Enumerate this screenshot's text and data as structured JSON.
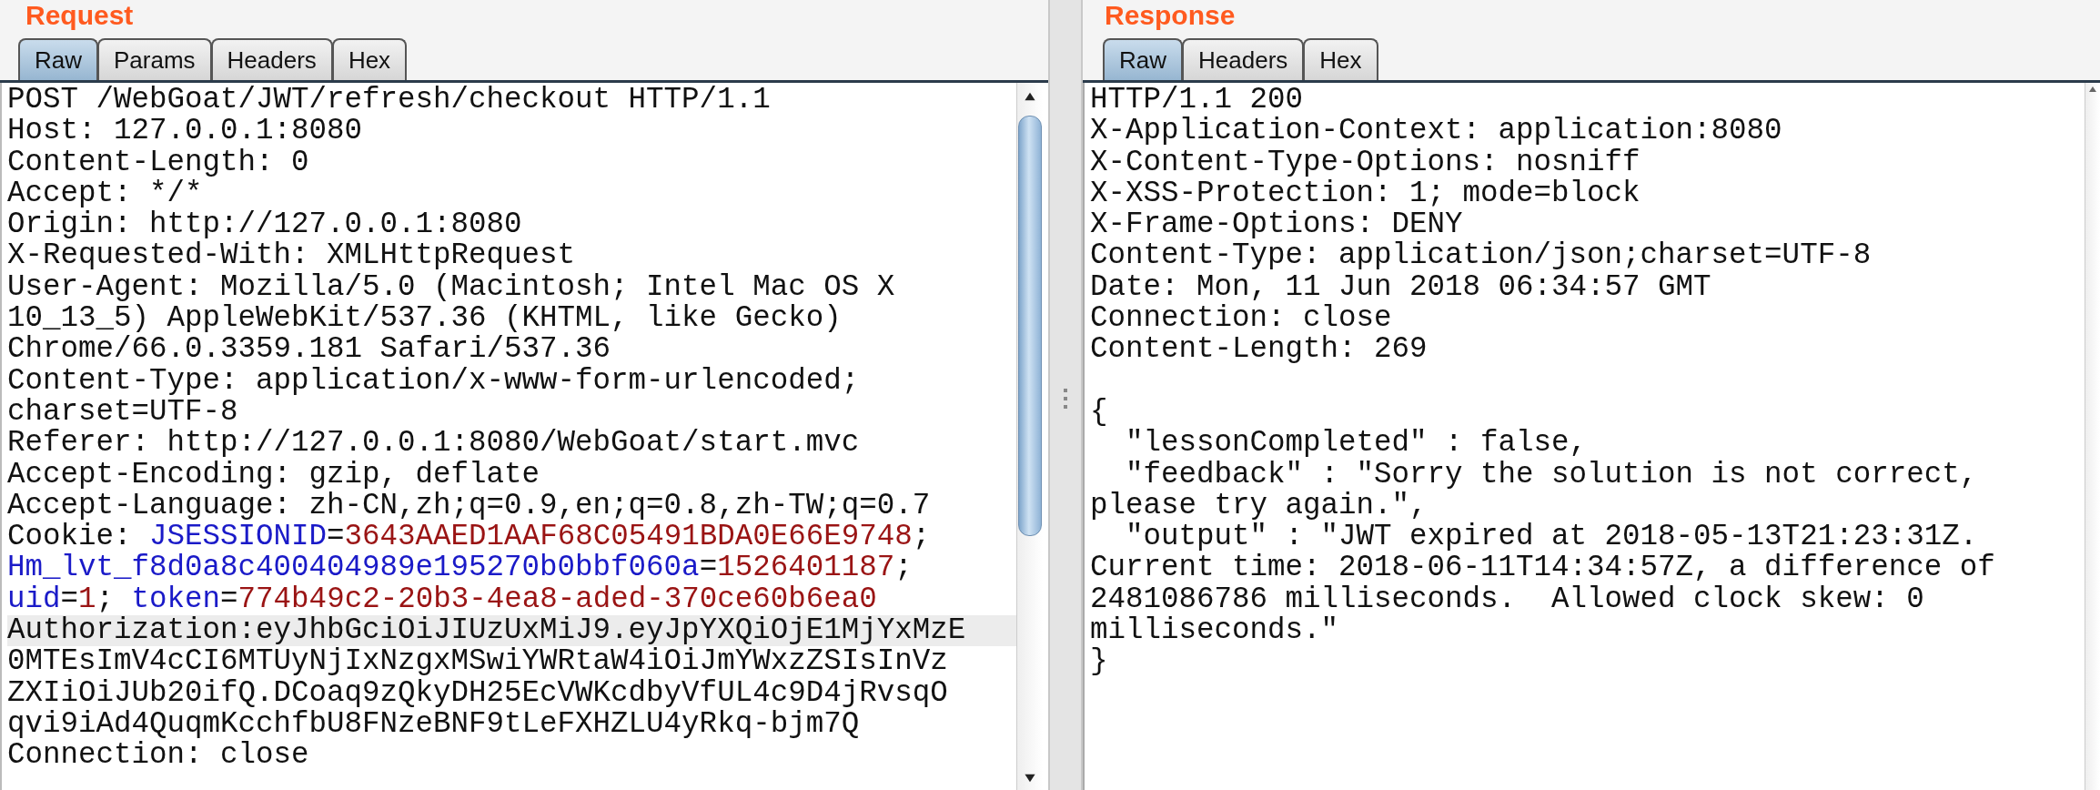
{
  "request": {
    "title": "Request",
    "tabs": [
      {
        "label": "Raw",
        "selected": true
      },
      {
        "label": "Params",
        "selected": false
      },
      {
        "label": "Headers",
        "selected": false
      },
      {
        "label": "Hex",
        "selected": false
      }
    ],
    "lines": [
      {
        "text": "POST /WebGoat/JWT/refresh/checkout HTTP/1.1",
        "highlighted": false
      },
      {
        "text": "Host: 127.0.0.1:8080",
        "highlighted": false
      },
      {
        "text": "Content-Length: 0",
        "highlighted": false
      },
      {
        "text": "Accept: */*",
        "highlighted": false
      },
      {
        "text": "Origin: http://127.0.0.1:8080",
        "highlighted": false
      },
      {
        "text": "X-Requested-With: XMLHttpRequest",
        "highlighted": false
      },
      {
        "text": "User-Agent: Mozilla/5.0 (Macintosh; Intel Mac OS X",
        "highlighted": false
      },
      {
        "text": "10_13_5) AppleWebKit/537.36 (KHTML, like Gecko)",
        "highlighted": false
      },
      {
        "text": "Chrome/66.0.3359.181 Safari/537.36",
        "highlighted": false
      },
      {
        "text": "Content-Type: application/x-www-form-urlencoded;",
        "highlighted": false
      },
      {
        "text": "charset=UTF-8",
        "highlighted": false
      },
      {
        "text": "Referer: http://127.0.0.1:8080/WebGoat/start.mvc",
        "highlighted": false
      },
      {
        "text": "Accept-Encoding: gzip, deflate",
        "highlighted": false
      },
      {
        "text": "Accept-Language: zh-CN,zh;q=0.9,en;q=0.8,zh-TW;q=0.7",
        "highlighted": false
      },
      {
        "highlighted": false,
        "segments": [
          {
            "kind": "plain",
            "text": "Cookie: "
          },
          {
            "kind": "name",
            "text": "JSESSIONID"
          },
          {
            "kind": "plain",
            "text": "="
          },
          {
            "kind": "value",
            "text": "3643AAED1AAF68C05491BDA0E66E9748"
          },
          {
            "kind": "plain",
            "text": ";"
          }
        ]
      },
      {
        "highlighted": false,
        "segments": [
          {
            "kind": "name",
            "text": "Hm_lvt_f8d0a8c400404989e195270b0bbf060a"
          },
          {
            "kind": "plain",
            "text": "="
          },
          {
            "kind": "value",
            "text": "1526401187"
          },
          {
            "kind": "plain",
            "text": ";"
          }
        ]
      },
      {
        "highlighted": false,
        "segments": [
          {
            "kind": "name",
            "text": "uid"
          },
          {
            "kind": "plain",
            "text": "="
          },
          {
            "kind": "value",
            "text": "1"
          },
          {
            "kind": "plain",
            "text": "; "
          },
          {
            "kind": "name",
            "text": "token"
          },
          {
            "kind": "plain",
            "text": "="
          },
          {
            "kind": "value",
            "text": "774b49c2-20b3-4ea8-aded-370ce60b6ea0"
          }
        ]
      },
      {
        "text": "Authorization:eyJhbGciOiJIUzUxMiJ9.eyJpYXQiOjE1MjYxMzE",
        "highlighted": true
      },
      {
        "text": "0MTEsImV4cCI6MTUyNjIxNzgxMSwiYWRtaW4iOiJmYWxzZSIsInVz",
        "highlighted": false
      },
      {
        "text": "ZXIiOiJUb20ifQ.DCoaq9zQkyDH25EcVWKcdbyVfUL4c9D4jRvsqO",
        "highlighted": false
      },
      {
        "text": "qvi9iAd4QuqmKcchfbU8FNzeBNF9tLeFXHZLU4yRkq-bjm7Q",
        "highlighted": false
      },
      {
        "text": "Connection: close",
        "highlighted": false
      }
    ]
  },
  "response": {
    "title": "Response",
    "tabs": [
      {
        "label": "Raw",
        "selected": true
      },
      {
        "label": "Headers",
        "selected": false
      },
      {
        "label": "Hex",
        "selected": false
      }
    ],
    "headers": [
      "HTTP/1.1 200",
      "X-Application-Context: application:8080",
      "X-Content-Type-Options: nosniff",
      "X-XSS-Protection: 1; mode=block",
      "X-Frame-Options: DENY",
      "Content-Type: application/json;charset=UTF-8",
      "Date: Mon, 11 Jun 2018 06:34:57 GMT",
      "Connection: close",
      "Content-Length: 269"
    ],
    "body": [
      "{",
      "  \"lessonCompleted\" : false,",
      "  \"feedback\" : \"Sorry the solution is not correct,",
      "please try again.\",",
      "  \"output\" : \"JWT expired at 2018-05-13T21:23:31Z.",
      "Current time: 2018-06-11T14:34:57Z, a difference of",
      "2481086786 milliseconds.  Allowed clock skew: 0",
      "milliseconds.\"",
      "}"
    ]
  }
}
